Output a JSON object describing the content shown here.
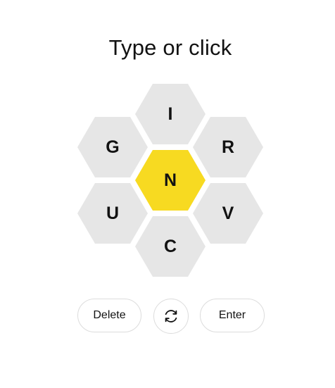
{
  "prompt": "Type or click",
  "letters": {
    "center": "N",
    "top": "I",
    "upper_left": "G",
    "upper_right": "R",
    "lower_left": "U",
    "lower_right": "V",
    "bottom": "C"
  },
  "controls": {
    "delete_label": "Delete",
    "shuffle_icon": "shuffle-icon",
    "enter_label": "Enter"
  },
  "colors": {
    "center_cell": "#f7da21",
    "outer_cell": "#e6e6e6",
    "text": "#121212",
    "button_border": "#dcdcdc"
  }
}
